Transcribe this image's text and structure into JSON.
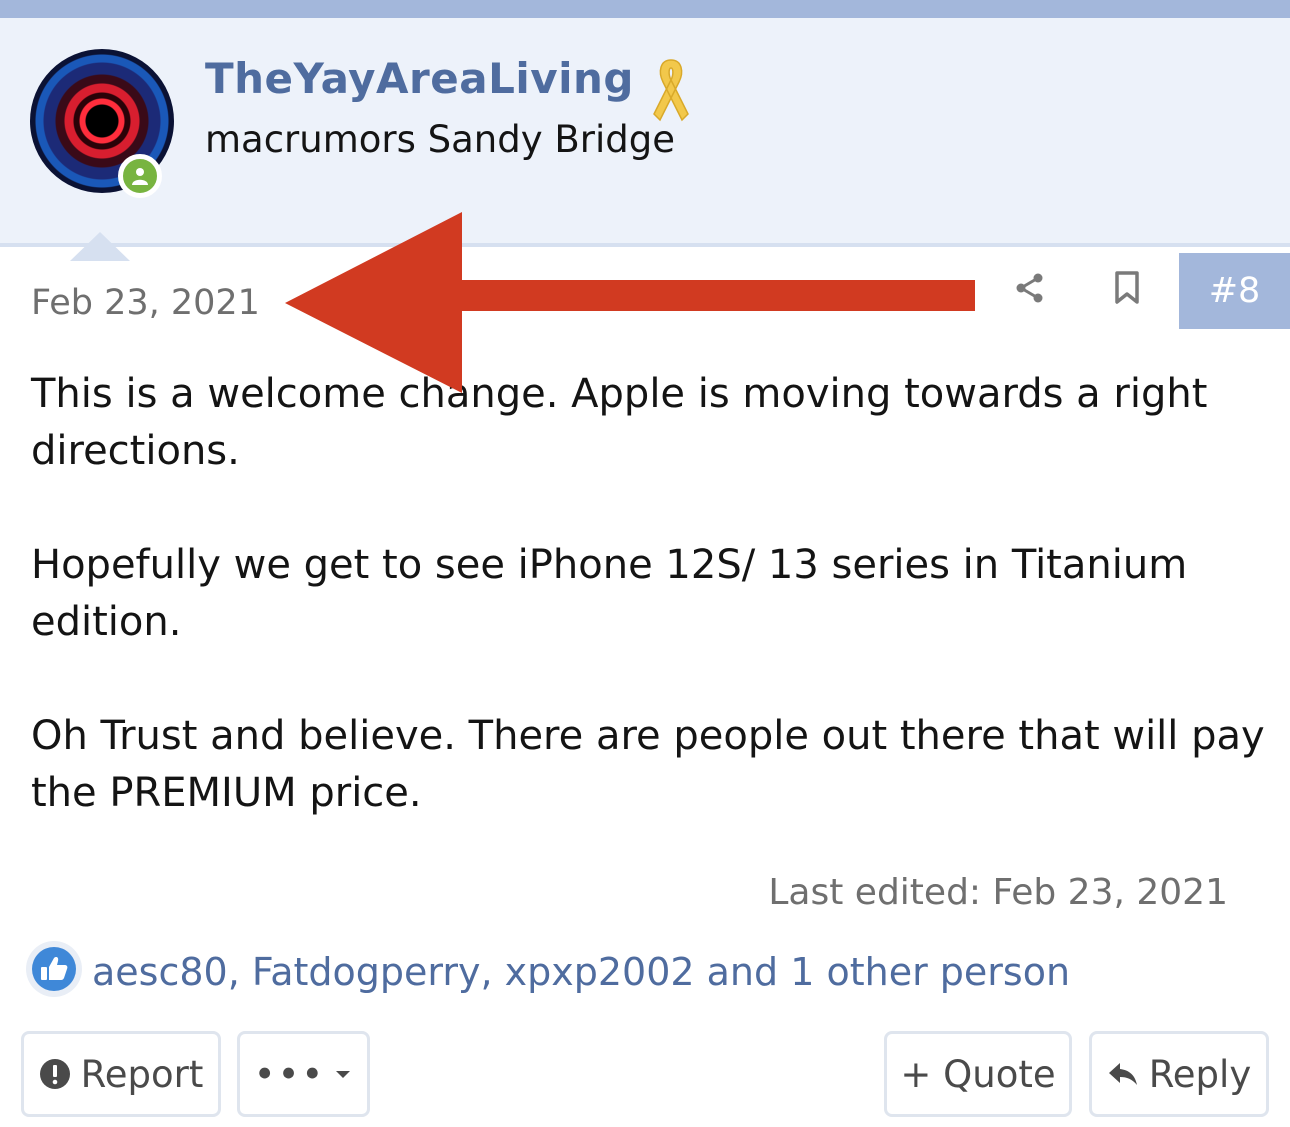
{
  "user": {
    "name": "TheYayAreaLiving",
    "title": "macrumors Sandy Bridge",
    "ribbon_icon": "ribbon-icon",
    "status_icon": "online-user-icon"
  },
  "post": {
    "date": "Feb 23, 2021",
    "number": "#8",
    "paragraphs": [
      "This is a welcome change. Apple is moving towards a right directions.",
      "Hopefully we get to see iPhone 12S/ 13 series in Titanium edition.",
      "Oh Trust and believe. There are people out there that will pay the PREMIUM price."
    ],
    "last_edited": "Last edited: Feb 23, 2021"
  },
  "reactions": {
    "text": "aesc80, Fatdogperry, xpxp2002 and 1 other person",
    "icon": "like-icon"
  },
  "actions": {
    "report": "Report",
    "more": "•••",
    "quote": "+ Quote",
    "reply": "Reply"
  },
  "colors": {
    "accent": "#4f6c9f",
    "header_bg": "#edf2fa",
    "post_number_bg": "#a3b7db",
    "annotation_arrow": "#d13a21",
    "online": "#78b440"
  }
}
